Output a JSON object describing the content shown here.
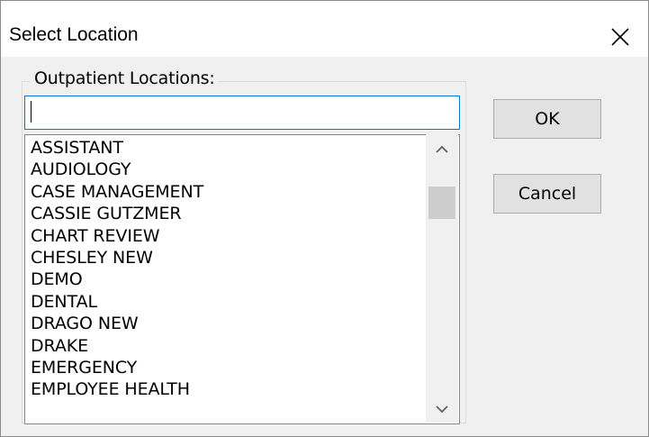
{
  "window": {
    "title": "Select Location",
    "close_icon": "close-x-icon"
  },
  "group": {
    "label": "Outpatient Locations:"
  },
  "search": {
    "value": ""
  },
  "list": {
    "items": [
      "ASSISTANT",
      "AUDIOLOGY",
      "CASE MANAGEMENT",
      "CASSIE GUTZMER",
      "CHART REVIEW",
      "CHESLEY NEW",
      "DEMO",
      "DENTAL",
      "DRAGO NEW",
      "DRAKE",
      "EMERGENCY",
      "EMPLOYEE HEALTH"
    ],
    "scroll_up_icon": "chevron-up-icon",
    "scroll_down_icon": "chevron-down-icon"
  },
  "buttons": {
    "ok": "OK",
    "cancel": "Cancel"
  },
  "colors": {
    "focus_border": "#0078d7",
    "dialog_bg": "#f0f0f0",
    "button_bg": "#e1e1e1"
  }
}
